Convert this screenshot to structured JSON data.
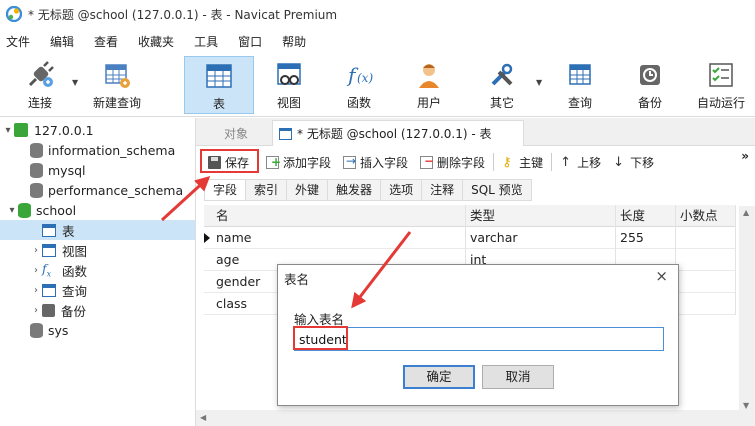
{
  "window": {
    "title": "* 无标题 @school (127.0.0.1) - 表 - Navicat Premium"
  },
  "menu": [
    "文件",
    "编辑",
    "查看",
    "收藏夹",
    "工具",
    "窗口",
    "帮助"
  ],
  "toolbar": {
    "connect": "连接",
    "new_query": "新建查询",
    "table": "表",
    "view": "视图",
    "function": "函数",
    "user": "用户",
    "other": "其它",
    "query": "查询",
    "backup": "备份",
    "automation": "自动运行"
  },
  "tree": {
    "connection": "127.0.0.1",
    "databases": [
      "information_schema",
      "mysql",
      "performance_schema",
      "school",
      "sys"
    ],
    "school_children": [
      "表",
      "视图",
      "函数",
      "查询",
      "备份"
    ]
  },
  "tabs": {
    "objects": "对象",
    "active": "* 无标题 @school (127.0.0.1) - 表"
  },
  "subtoolbar": {
    "save": "保存",
    "add_field": "添加字段",
    "insert_field": "插入字段",
    "delete_field": "删除字段",
    "primary_key": "主键",
    "move_up": "上移",
    "move_down": "下移"
  },
  "field_tabs": [
    "字段",
    "索引",
    "外键",
    "触发器",
    "选项",
    "注释",
    "SQL 预览"
  ],
  "grid": {
    "headers": [
      "名",
      "类型",
      "长度",
      "小数点"
    ],
    "rows": [
      [
        "name",
        "varchar",
        "255",
        ""
      ],
      [
        "age",
        "int",
        "",
        ""
      ],
      [
        "gender",
        "",
        "",
        ""
      ],
      [
        "class",
        "",
        "",
        ""
      ]
    ]
  },
  "dialog": {
    "title": "表名",
    "label": "输入表名",
    "value": "student",
    "ok": "确定",
    "cancel": "取消",
    "close": "×"
  },
  "colors": {
    "accent": "#cce4f7",
    "highlight": "#e53935",
    "db_icon": "#7a7a7a",
    "db_active": "#3aa63a"
  }
}
